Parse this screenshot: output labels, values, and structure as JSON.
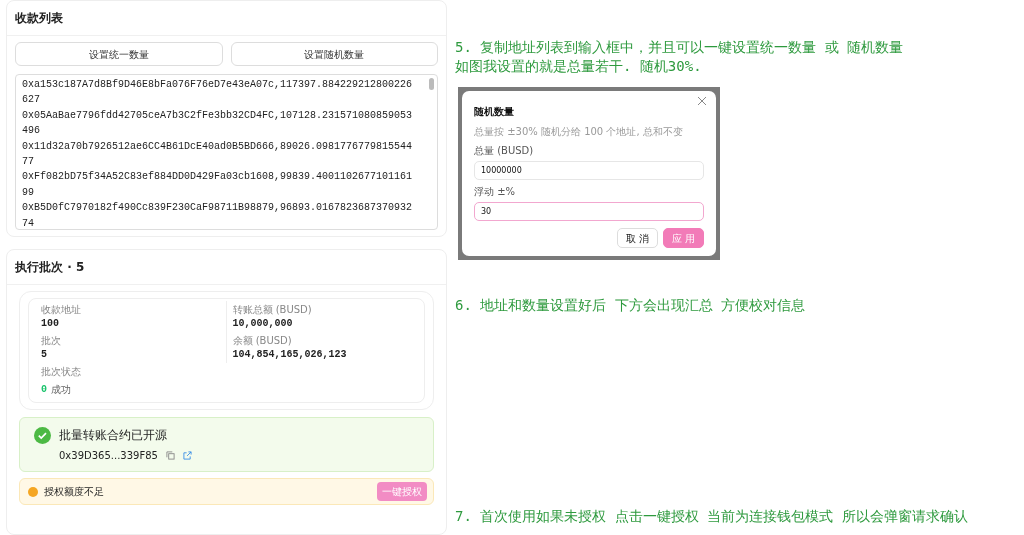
{
  "receive_list": {
    "title": "收款列表",
    "buttons": [
      "设置统一数量",
      "设置随机数量"
    ],
    "entries": [
      "0xa153c187A7d8Bf9D46E8bFa076F76eD7e43eA07c,117397.884229212800226627",
      "0x05AaBae7796fdd42705ceA7b3C2fFe3bb32CD4FC,107128.231571080859053496",
      "0x11d32a70b7926512ae6CC4B61DcE40ad0B5BD666,89026.098177677981554477",
      "0xFf082bD75f34A52C83ef884DD0D429Fa03cb1608,99839.400110267710116199",
      "0xB5D0fC7970182f490Cc839F230CaF98711B98879,96893.016782368737093274"
    ]
  },
  "batch": {
    "title": "执行批次 · 5",
    "summary": [
      {
        "label": "收款地址",
        "value": "100"
      },
      {
        "label": "转账总额 (BUSD)",
        "value": "10,000,000"
      },
      {
        "label": "批次",
        "value": "5"
      },
      {
        "label": "余额 (BUSD)",
        "value": "104,854,165,026,123"
      }
    ],
    "status": {
      "label": "批次状态",
      "count": "0",
      "text": "成功"
    },
    "contract_notice": {
      "title": "批量转账合约已开源",
      "address": "0x39D365...339F85"
    },
    "allowance_warning": {
      "text": "授权额度不足",
      "button": "一键授权"
    }
  },
  "notes": [
    {
      "lines": [
        "5. 复制地址列表到输入框中，并且可以一键设置统一数量 或 随机数量",
        "如图我设置的就是总量若干. 随机30%."
      ]
    },
    {
      "lines": [
        "6. 地址和数量设置好后  下方会出现汇总  方便校对信息"
      ]
    },
    {
      "lines": [
        "7. 首次使用如果未授权  点击一键授权  当前为连接钱包模式  所以会弹窗请求确认"
      ]
    }
  ],
  "dialog": {
    "title": "随机数量",
    "subtitle": "总量按 ±30% 随机分给 100 个地址, 总和不变",
    "fields": [
      {
        "label": "总量 (BUSD)",
        "value": "10000000",
        "focused": false
      },
      {
        "label": "浮动 ±%",
        "value": "30",
        "focused": true
      }
    ],
    "buttons": [
      {
        "label": "取 消",
        "kind": "secondary"
      },
      {
        "label": "应 用",
        "kind": "primary"
      }
    ]
  }
}
